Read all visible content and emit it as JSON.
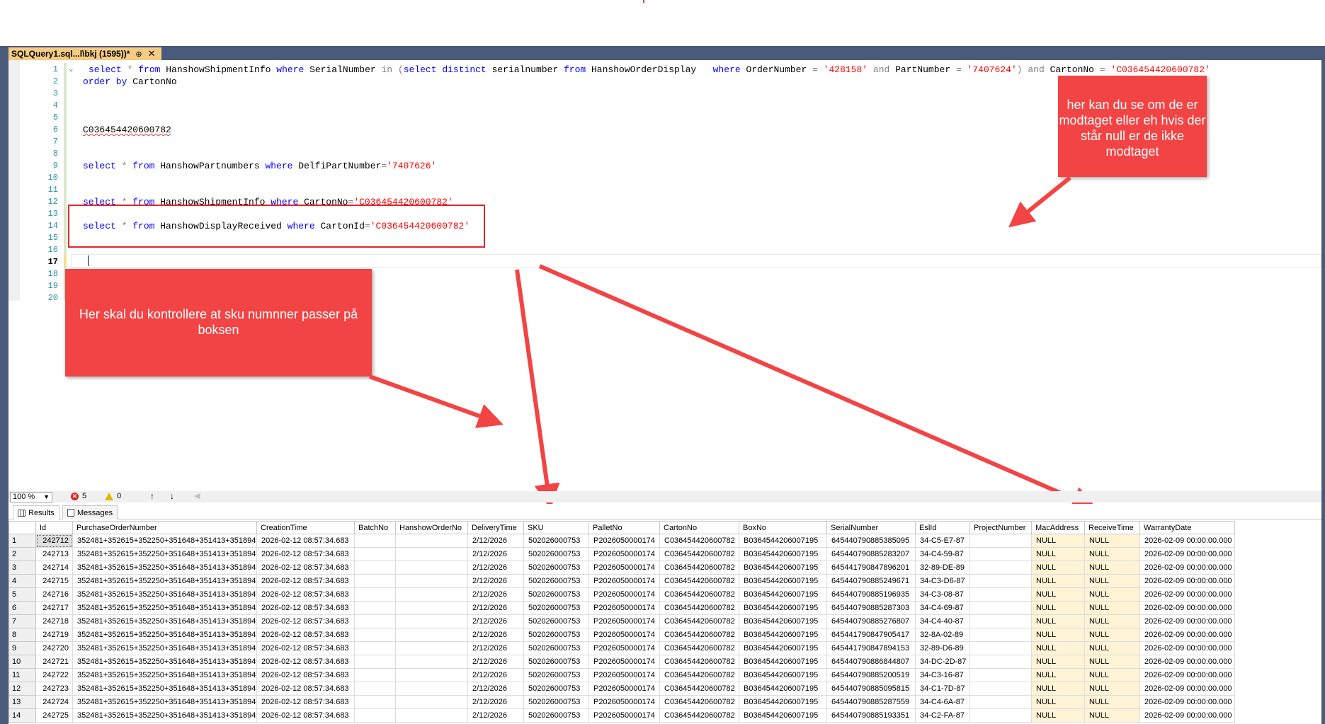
{
  "tab": {
    "title": "SQLQuery1.sql...l\\bkj (1595))*",
    "pin": "⊕",
    "close": "✕"
  },
  "editor": {
    "lines": [
      {
        "n": "1",
        "tokens": [
          [
            "kw",
            "select "
          ],
          [
            "gray",
            "* "
          ],
          [
            "kw",
            "from "
          ],
          [
            "ident",
            "HanshowShipmentInfo "
          ],
          [
            "kw",
            "where "
          ],
          [
            "ident",
            "SerialNumber "
          ],
          [
            "gray",
            "in ("
          ],
          [
            "kw",
            "select distinct "
          ],
          [
            "ident",
            "serialnumber "
          ],
          [
            "kw",
            "from "
          ],
          [
            "ident",
            "HanshowOrderDisplay   "
          ],
          [
            "kw",
            "where "
          ],
          [
            "ident",
            "OrderNumber "
          ],
          [
            "gray",
            "= "
          ],
          [
            "str",
            "'428158' "
          ],
          [
            "gray",
            "and "
          ],
          [
            "ident",
            "PartNumber "
          ],
          [
            "gray",
            "= "
          ],
          [
            "str",
            "'7407624'"
          ],
          [
            "gray",
            ") and "
          ],
          [
            "ident",
            "CartonNo "
          ],
          [
            "gray",
            "= "
          ],
          [
            "str",
            "'C036454420600782'"
          ]
        ]
      },
      {
        "n": "2",
        "tokens": [
          [
            "kw",
            "order by "
          ],
          [
            "ident",
            "CartonNo"
          ]
        ]
      },
      {
        "n": "3",
        "tokens": []
      },
      {
        "n": "4",
        "tokens": []
      },
      {
        "n": "5",
        "tokens": []
      },
      {
        "n": "6",
        "tokens": [
          [
            "squig",
            "C036454420600782"
          ]
        ]
      },
      {
        "n": "7",
        "tokens": []
      },
      {
        "n": "8",
        "tokens": []
      },
      {
        "n": "9",
        "tokens": [
          [
            "kw",
            "select "
          ],
          [
            "gray",
            "* "
          ],
          [
            "kw",
            "from "
          ],
          [
            "ident",
            "HanshowPartnumbers "
          ],
          [
            "kw",
            "where "
          ],
          [
            "ident",
            "DelfiPartNumber"
          ],
          [
            "gray",
            "="
          ],
          [
            "str",
            "'7407626'"
          ]
        ]
      },
      {
        "n": "10",
        "tokens": []
      },
      {
        "n": "11",
        "tokens": []
      },
      {
        "n": "12",
        "tokens": [
          [
            "kw",
            "select "
          ],
          [
            "gray",
            "* "
          ],
          [
            "kw",
            "from "
          ],
          [
            "ident",
            "HanshowShipmentInfo "
          ],
          [
            "kw",
            "where "
          ],
          [
            "ident",
            "CartonNo"
          ],
          [
            "gray",
            "="
          ],
          [
            "str",
            "'C036454420600782'"
          ]
        ]
      },
      {
        "n": "13",
        "tokens": []
      },
      {
        "n": "14",
        "tokens": [
          [
            "kw",
            "select "
          ],
          [
            "gray",
            "* "
          ],
          [
            "kw",
            "from "
          ],
          [
            "ident",
            "HanshowDisplayReceived "
          ],
          [
            "kw",
            "where "
          ],
          [
            "ident",
            "CartonId"
          ],
          [
            "gray",
            "="
          ],
          [
            "str",
            "'C036454420600782'"
          ]
        ]
      },
      {
        "n": "15",
        "tokens": []
      },
      {
        "n": "16",
        "tokens": []
      },
      {
        "n": "17",
        "tokens": []
      },
      {
        "n": "18",
        "tokens": []
      },
      {
        "n": "19",
        "tokens": []
      },
      {
        "n": "20",
        "tokens": []
      }
    ],
    "current_line": "17"
  },
  "callouts": {
    "right": "her kan du se om de er modtaget eller eh hvis der står null er de ikke modtaget",
    "left": "Her skal du kontrollere at sku numnner passer på boksen"
  },
  "statusbar": {
    "zoom": "100 %",
    "errors": "5",
    "warnings": "0"
  },
  "results_tabs": {
    "results": "Results",
    "messages": "Messages"
  },
  "grid": {
    "columns": [
      "",
      "Id",
      "PurchaseOrderNumber",
      "CreationTime",
      "BatchNo",
      "HanshowOrderNo",
      "DeliveryTime",
      "SKU",
      "PalletNo",
      "CartonNo",
      "BoxNo",
      "SerialNumber",
      "EslId",
      "ProjectNumber",
      "MacAddress",
      "ReceiveTime",
      "WarrantyDate"
    ],
    "rows": [
      [
        "1",
        "242712",
        "352481+352615+352250+351648+351413+351894",
        "2026-02-12 08:57:34.683",
        "",
        "",
        "2/12/2026",
        "502026000753",
        "P2026050000174",
        "C036454420600782",
        "B0364544206007195",
        "6454407908853850​95",
        "34-C5-E7-87",
        "",
        "NULL",
        "NULL",
        "2026-02-09 00:00:00.000"
      ],
      [
        "2",
        "242713",
        "352481+352615+352250+351648+351413+351894",
        "2026-02-12 08:57:34.683",
        "",
        "",
        "2/12/2026",
        "502026000753",
        "P2026050000174",
        "C036454420600782",
        "B0364544206007195",
        "645440790885283207",
        "34-C4-59-87",
        "",
        "NULL",
        "NULL",
        "2026-02-09 00:00:00.000"
      ],
      [
        "3",
        "242714",
        "352481+352615+352250+351648+351413+351894",
        "2026-02-12 08:57:34.683",
        "",
        "",
        "2/12/2026",
        "502026000753",
        "P2026050000174",
        "C036454420600782",
        "B0364544206007195",
        "645441790847896201",
        "32-89-DE-89",
        "",
        "NULL",
        "NULL",
        "2026-02-09 00:00:00.000"
      ],
      [
        "4",
        "242715",
        "352481+352615+352250+351648+351413+351894",
        "2026-02-12 08:57:34.683",
        "",
        "",
        "2/12/2026",
        "502026000753",
        "P2026050000174",
        "C036454420600782",
        "B0364544206007195",
        "645440790885249671",
        "34-C3-D6-87",
        "",
        "NULL",
        "NULL",
        "2026-02-09 00:00:00.000"
      ],
      [
        "5",
        "242716",
        "352481+352615+352250+351648+351413+351894",
        "2026-02-12 08:57:34.683",
        "",
        "",
        "2/12/2026",
        "502026000753",
        "P2026050000174",
        "C036454420600782",
        "B0364544206007195",
        "645440790885196935",
        "34-C3-08-87",
        "",
        "NULL",
        "NULL",
        "2026-02-09 00:00:00.000"
      ],
      [
        "6",
        "242717",
        "352481+352615+352250+351648+351413+351894",
        "2026-02-12 08:57:34.683",
        "",
        "",
        "2/12/2026",
        "502026000753",
        "P2026050000174",
        "C036454420600782",
        "B0364544206007195",
        "645440790885287303",
        "34-C4-69-87",
        "",
        "NULL",
        "NULL",
        "2026-02-09 00:00:00.000"
      ],
      [
        "7",
        "242718",
        "352481+352615+352250+351648+351413+351894",
        "2026-02-12 08:57:34.683",
        "",
        "",
        "2/12/2026",
        "502026000753",
        "P2026050000174",
        "C036454420600782",
        "B0364544206007195",
        "645440790885276807",
        "34-C4-40-87",
        "",
        "NULL",
        "NULL",
        "2026-02-09 00:00:00.000"
      ],
      [
        "8",
        "242719",
        "352481+352615+352250+351648+351413+351894",
        "2026-02-12 08:57:34.683",
        "",
        "",
        "2/12/2026",
        "502026000753",
        "P2026050000174",
        "C036454420600782",
        "B0364544206007195",
        "645441790847905417",
        "32-8A-02-89",
        "",
        "NULL",
        "NULL",
        "2026-02-09 00:00:00.000"
      ],
      [
        "9",
        "242720",
        "352481+352615+352250+351648+351413+351894",
        "2026-02-12 08:57:34.683",
        "",
        "",
        "2/12/2026",
        "502026000753",
        "P2026050000174",
        "C036454420600782",
        "B0364544206007195",
        "645441790847894153",
        "32-89-D6-89",
        "",
        "NULL",
        "NULL",
        "2026-02-09 00:00:00.000"
      ],
      [
        "10",
        "242721",
        "352481+352615+352250+351648+351413+351894",
        "2026-02-12 08:57:34.683",
        "",
        "",
        "2/12/2026",
        "502026000753",
        "P2026050000174",
        "C036454420600782",
        "B0364544206007195",
        "645440790886844807",
        "34-DC-2D-87",
        "",
        "NULL",
        "NULL",
        "2026-02-09 00:00:00.000"
      ],
      [
        "11",
        "242722",
        "352481+352615+352250+351648+351413+351894",
        "2026-02-12 08:57:34.683",
        "",
        "",
        "2/12/2026",
        "502026000753",
        "P2026050000174",
        "C036454420600782",
        "B0364544206007195",
        "645440790885200519",
        "34-C3-16-87",
        "",
        "NULL",
        "NULL",
        "2026-02-09 00:00:00.000"
      ],
      [
        "12",
        "242723",
        "352481+352615+352250+351648+351413+351894",
        "2026-02-12 08:57:34.683",
        "",
        "",
        "2/12/2026",
        "502026000753",
        "P2026050000174",
        "C036454420600782",
        "B0364544206007195",
        "645440790885095815",
        "34-C1-7D-87",
        "",
        "NULL",
        "NULL",
        "2026-02-09 00:00:00.000"
      ],
      [
        "13",
        "242724",
        "352481+352615+352250+351648+351413+351894",
        "2026-02-12 08:57:34.683",
        "",
        "",
        "2/12/2026",
        "502026000753",
        "P2026050000174",
        "C036454420600782",
        "B0364544206007195",
        "645440790885287559",
        "34-C4-6A-87",
        "",
        "NULL",
        "NULL",
        "2026-02-09 00:00:00.000"
      ],
      [
        "14",
        "242725",
        "352481+352615+352250+351648+351413+351894",
        "2026-02-12 08:57:34.683",
        "",
        "",
        "2/12/2026",
        "502026000753",
        "P2026050000174",
        "C036454420600782",
        "B0364544206007195",
        "645440790885193351",
        "34-C2-FA-87",
        "",
        "NULL",
        "NULL",
        "2026-02-09 00:00:00.000"
      ]
    ]
  },
  "colors": {
    "frame": "#495a7a",
    "tab_active": "#f5cc84",
    "callout": "#f24444",
    "highlight": "#e0262b",
    "null_cell": "#fff3d6"
  }
}
